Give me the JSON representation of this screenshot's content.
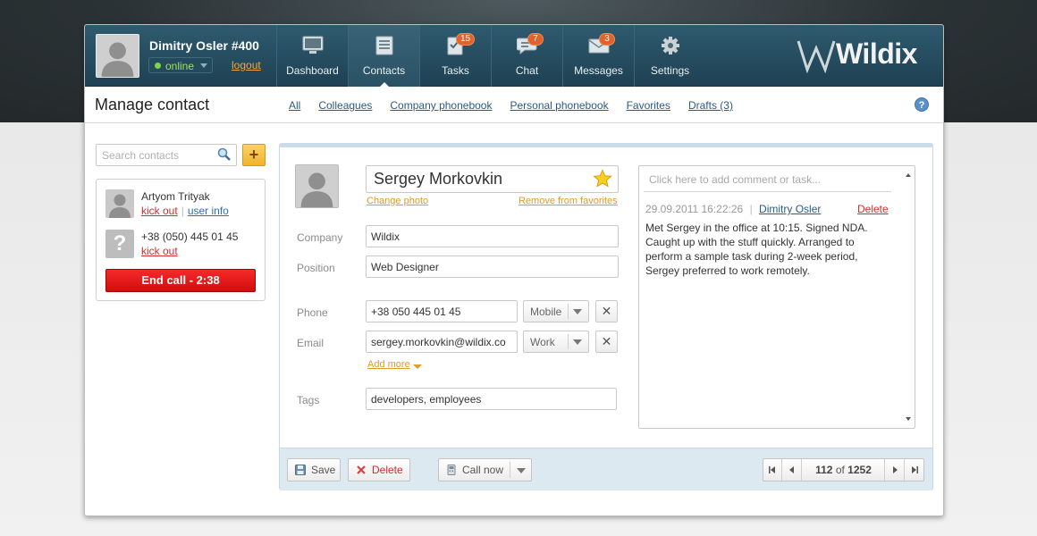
{
  "user": {
    "name": "Dimitry Osler #400",
    "status": "online",
    "logout_label": "logout"
  },
  "nav": [
    {
      "label": "Dashboard",
      "icon": "monitor-icon",
      "badge": ""
    },
    {
      "label": "Contacts",
      "icon": "contacts-icon",
      "badge": ""
    },
    {
      "label": "Tasks",
      "icon": "tasks-icon",
      "badge": "15"
    },
    {
      "label": "Chat",
      "icon": "chat-icon",
      "badge": "7"
    },
    {
      "label": "Messages",
      "icon": "envelope-icon",
      "badge": "3"
    },
    {
      "label": "Settings",
      "icon": "gear-icon",
      "badge": ""
    }
  ],
  "brand": "Wildix",
  "page": {
    "title": "Manage contact",
    "filters": [
      "All",
      "Colleagues",
      "Company phonebook",
      "Personal phonebook",
      "Favorites",
      "Drafts (3)"
    ],
    "help": "?"
  },
  "sidebar": {
    "search_placeholder": "Search contacts",
    "add_label": "+",
    "call": {
      "participants": [
        {
          "name": "Artyom Trityak",
          "kick": "kick out",
          "info": "user info"
        },
        {
          "name": "+38 (050) 445 01 45",
          "kick": "kick out"
        }
      ],
      "end_call_label": "End call - 2:38"
    }
  },
  "contact": {
    "name": "Sergey Morkovkin",
    "change_photo": "Change photo",
    "remove_favorites": "Remove from favorites",
    "company_label": "Company",
    "company": "Wildix",
    "position_label": "Position",
    "position": "Web Designer",
    "phone_label": "Phone",
    "phone": "+38 050 445 01 45",
    "phone_type": "Mobile",
    "email_label": "Email",
    "email": "sergey.morkovkin@wildix.co",
    "email_type": "Work",
    "add_more": "Add more",
    "tags_label": "Tags",
    "tags": "developers, employees"
  },
  "comments": {
    "placeholder": "Click here to add comment or task...",
    "items": [
      {
        "date": "29.09.2011 16:22:26",
        "separator": "|",
        "author": "Dimitry Osler",
        "delete": "Delete",
        "text": "Met Sergey in the office at 10:15. Signed NDA. Caught up with the stuff quickly. Arranged to perform a sample task during 2-week period, Sergey preferred to work remotely."
      }
    ]
  },
  "footer": {
    "save": "Save",
    "delete": "Delete",
    "call_now": "Call now",
    "pager": {
      "current": "112",
      "of": "of",
      "total": "1252"
    }
  },
  "colors": {
    "header": "#1e4153",
    "accent": "#f3a53b",
    "danger": "#d40c0c",
    "link": "#2c5b85"
  }
}
